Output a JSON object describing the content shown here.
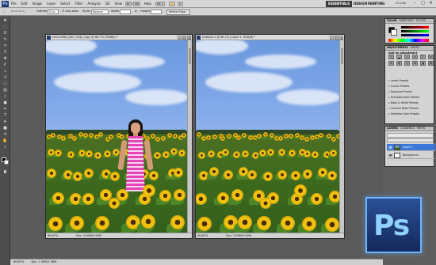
{
  "app": {
    "logo_text": "Ps",
    "menu": [
      "File",
      "Edit",
      "Image",
      "Layer",
      "Select",
      "Filter",
      "Analysis",
      "3D",
      "View",
      "Window",
      "Help"
    ],
    "zoom_readout": "66.7",
    "workspaces": [
      "ESSENTIALS",
      "DESIGN",
      "PAINTING"
    ],
    "active_workspace": "ESSENTIALS",
    "cs_live": "CS Live"
  },
  "options_bar": {
    "feather_label": "Feather:",
    "feather_value": "0 px",
    "antialias_label": "Anti-alias",
    "style_label": "Style:",
    "style_value": "Normal",
    "width_label": "Width:",
    "height_label": "Height:",
    "refine_edge": "Refine Edge..."
  },
  "documents": [
    {
      "title": "DSC00968_DXO_ORD_Copy @ 66.7% (RGB/8) *",
      "zoom": "66.67%",
      "doc_size": "Doc: 3.60M/3.60M",
      "has_person": true
    },
    {
      "title": "Untitled-1 @ 66.7% (Layer 1, RGB/8) *",
      "zoom": "66.67%",
      "doc_size": "Doc: 3.60M/3.60M",
      "has_person": false
    }
  ],
  "panels": {
    "color": {
      "tabs": [
        "COLOR",
        "SWATCHES",
        "STYLES"
      ]
    },
    "adjustments": {
      "tabs": [
        "ADJUSTMENTS",
        "MASKS"
      ],
      "heading": "Add an adjustment",
      "presets": [
        "Levels Presets",
        "Curves Presets",
        "Exposure Presets",
        "Hue/Saturation Presets",
        "Black & White Presets",
        "Channel Mixer Presets",
        "Selective Color Presets"
      ]
    },
    "layers": {
      "tabs": [
        "LAYERS",
        "CHANNELS",
        "PATHS"
      ],
      "items": [
        {
          "name": "Layer 1",
          "selected": true
        },
        {
          "name": "Background",
          "selected": false
        }
      ]
    }
  },
  "status_bar": {
    "zoom": "66.67%",
    "doc_size": "Doc: 1.98M/1.98M"
  },
  "colors": {
    "accent": "#3c78d8",
    "ps_brand": "#8fd2ff",
    "dress": "#e742b8"
  },
  "badge": {
    "text": "Ps"
  }
}
